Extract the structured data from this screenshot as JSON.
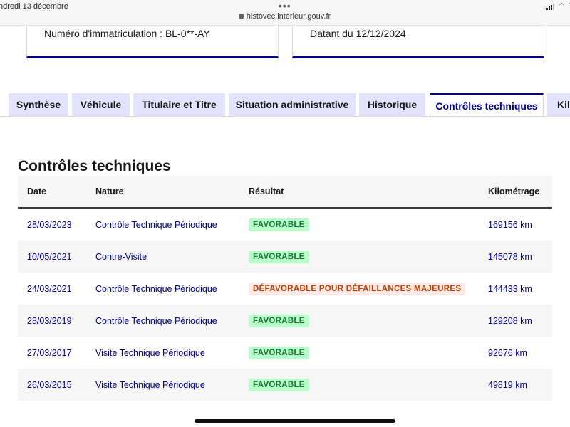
{
  "status_bar": {
    "date": "ndredi 13 décembre",
    "dots": "•••",
    "url": "histovec.interieur.gouv.fr",
    "battery": "7"
  },
  "cards": {
    "left_text": "Numéro d'immatriculation : BL-0**-AY",
    "right_text": "Datant du 12/12/2024"
  },
  "tabs": [
    {
      "label": "Synthèse"
    },
    {
      "label": "Véhicule"
    },
    {
      "label": "Titulaire et Titre"
    },
    {
      "label": "Situation administrative"
    },
    {
      "label": "Historique"
    },
    {
      "label": "Contrôles techniques"
    },
    {
      "label": "Kil"
    }
  ],
  "active_tab": "Contrôles techniques",
  "section_title": "Contrôles techniques",
  "table": {
    "headers": {
      "date": "Date",
      "nature": "Nature",
      "result": "Résultat",
      "km": "Kilométrage"
    },
    "rows": [
      {
        "date": "28/03/2023",
        "nature": "Contrôle Technique Périodique",
        "result": "FAVORABLE",
        "status": "ok",
        "km": "169156 km"
      },
      {
        "date": "10/05/2021",
        "nature": "Contre-Visite",
        "result": "FAVORABLE",
        "status": "ok",
        "km": "145078 km"
      },
      {
        "date": "24/03/2021",
        "nature": "Contrôle Technique Périodique",
        "result": "DÉFAVORABLE POUR DÉFAILLANCES MAJEURES",
        "status": "ko",
        "km": "144433 km"
      },
      {
        "date": "28/03/2019",
        "nature": "Contrôle Technique Périodique",
        "result": "FAVORABLE",
        "status": "ok",
        "km": "129208 km"
      },
      {
        "date": "27/03/2017",
        "nature": "Visite Technique Périodique",
        "result": "FAVORABLE",
        "status": "ok",
        "km": "92676 km"
      },
      {
        "date": "26/03/2015",
        "nature": "Visite Technique Périodique",
        "result": "FAVORABLE",
        "status": "ok",
        "km": "49819 km"
      }
    ]
  },
  "colors": {
    "accent": "#000091",
    "tab_bg": "#e3e3fd",
    "success_bg": "#b8fec9",
    "success_text": "#18753c",
    "error_bg": "#ffe9e6",
    "error_text": "#b34000"
  }
}
